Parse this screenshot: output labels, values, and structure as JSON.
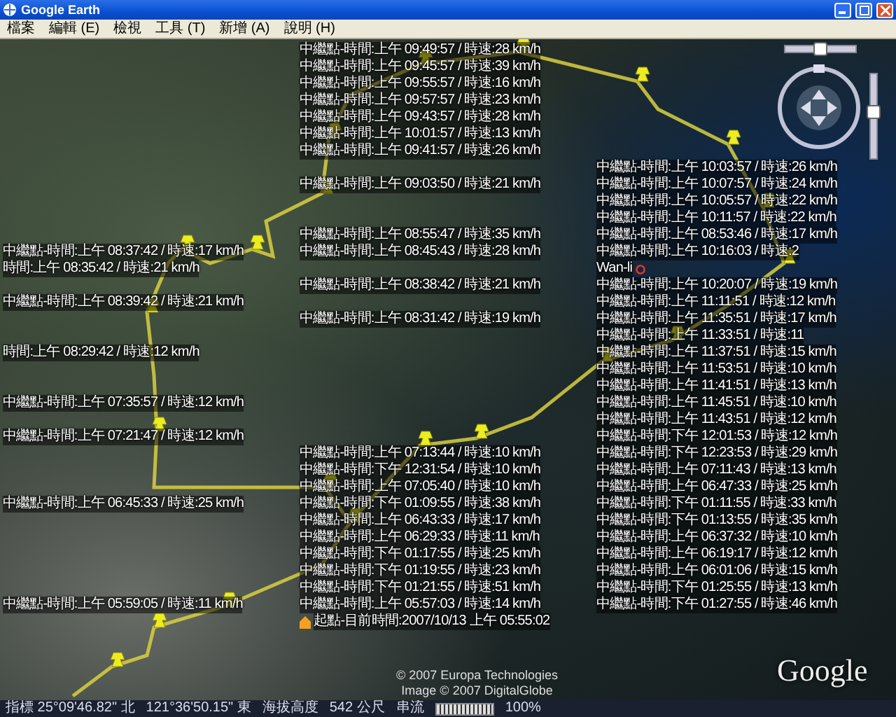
{
  "window": {
    "title": "Google Earth"
  },
  "menu": [
    "檔案",
    "編輯 (E)",
    "檢視",
    "工具 (T)",
    "新增 (A)",
    "說明 (H)"
  ],
  "map": {
    "labels": [
      {
        "kind": "waypoint",
        "text": "中繼點-時間:上午 09:49:57 / 時速:28 km/h"
      },
      {
        "kind": "waypoint",
        "text": "中繼點-時間:上午 09:45:57 / 時速:39 km/h"
      },
      {
        "kind": "waypoint",
        "text": "中繼點-時間:上午 09:55:57 / 時速:16 km/h"
      },
      {
        "kind": "waypoint",
        "text": "中繼點-時間:上午 09:57:57 / 時速:23 km/h"
      },
      {
        "kind": "waypoint",
        "text": "中繼點-時間:上午 09:43:57 / 時速:28 km/h"
      },
      {
        "kind": "waypoint",
        "text": "中繼點-時間:上午 10:01:57 / 時速:13 km/h"
      },
      {
        "kind": "waypoint",
        "text": "中繼點-時間:上午 09:41:57 / 時速:26 km/h"
      },
      {
        "kind": "waypoint",
        "text": "中繼點-時間:上午 10:03:57 / 時速:26 km/h"
      },
      {
        "kind": "waypoint",
        "text": "中繼點-時間:上午 09:03:50 / 時速:21 km/h"
      },
      {
        "kind": "waypoint",
        "text": "中繼點-時間:上午 10:07:57 / 時速:24 km/h"
      },
      {
        "kind": "waypoint",
        "text": "中繼點-時間:上午 10:05:57 / 時速:22 km/h"
      },
      {
        "kind": "waypoint",
        "text": "中繼點-時間:上午 10:11:57 / 時速:22 km/h"
      },
      {
        "kind": "waypoint",
        "text": "中繼點-時間:上午 08:55:47 / 時速:35 km/h"
      },
      {
        "kind": "waypoint",
        "text": "中繼點-時間:上午 08:53:46 / 時速:17 km/h"
      },
      {
        "kind": "waypoint",
        "text": "中繼點-時間:上午 08:37:42 / 時速:17 km/h"
      },
      {
        "kind": "waypoint",
        "text": "中繼點-時間:上午 08:45:43 / 時速:28 km/h"
      },
      {
        "kind": "waypoint",
        "text": "中繼點-時間:上午 10:16:03 / 時速:2"
      },
      {
        "kind": "waypoint",
        "text": "時間:上午 08:35:42 / 時速:21 km/h"
      },
      {
        "kind": "place",
        "text": "Wan-li"
      },
      {
        "kind": "waypoint",
        "text": "中繼點-時間:上午 08:38:42 / 時速:21 km/h"
      },
      {
        "kind": "waypoint",
        "text": "中繼點-時間:上午 10:20:07 / 時速:19 km/h"
      },
      {
        "kind": "waypoint",
        "text": "中繼點-時間:上午 08:39:42 / 時速:21 km/h"
      },
      {
        "kind": "waypoint",
        "text": "中繼點-時間:上午 11:11:51 / 時速:12 km/h"
      },
      {
        "kind": "waypoint",
        "text": "中繼點-時間:上午 08:31:42 / 時速:19 km/h"
      },
      {
        "kind": "waypoint",
        "text": "中繼點-時間:上午 11:35:51 / 時速:17 km/h"
      },
      {
        "kind": "waypoint",
        "text": "中繼點-時間:上午 11:33:51 / 時速:11"
      },
      {
        "kind": "waypoint",
        "text": "時間:上午 08:29:42 / 時速:12 km/h"
      },
      {
        "kind": "waypoint",
        "text": "中繼點-時間:上午 11:37:51 / 時速:15 km/h"
      },
      {
        "kind": "waypoint",
        "text": "中繼點-時間:上午 11:53:51 / 時速:10 km/h"
      },
      {
        "kind": "waypoint",
        "text": "中繼點-時間:上午 11:41:51 / 時速:13 km/h"
      },
      {
        "kind": "waypoint",
        "text": "中繼點-時間:上午 07:35:57 / 時速:12 km/h"
      },
      {
        "kind": "waypoint",
        "text": "中繼點-時間:上午 11:45:51 / 時速:10 km/h"
      },
      {
        "kind": "waypoint",
        "text": "中繼點-時間:上午 11:43:51 / 時速:12 km/h"
      },
      {
        "kind": "waypoint",
        "text": "中繼點-時間:上午 07:21:47 / 時速:12 km/h"
      },
      {
        "kind": "waypoint",
        "text": "中繼點-時間:下午 12:01:53 / 時速:12 km/h"
      },
      {
        "kind": "waypoint",
        "text": "中繼點-時間:上午 07:13:44 / 時速:10 km/h"
      },
      {
        "kind": "waypoint",
        "text": "中繼點-時間:下午 12:23:53 / 時速:29 km/h"
      },
      {
        "kind": "waypoint",
        "text": "中繼點-時間:下午 12:31:54 / 時速:10 km/h"
      },
      {
        "kind": "waypoint",
        "text": "中繼點-時間:上午 07:11:43 / 時速:13 km/h"
      },
      {
        "kind": "waypoint",
        "text": "中繼點-時間:上午 07:05:40 / 時速:10 km/h"
      },
      {
        "kind": "waypoint",
        "text": "中繼點-時間:上午 06:47:33 / 時速:25 km/h"
      },
      {
        "kind": "waypoint",
        "text": "中繼點-時間:上午 06:45:33 / 時速:25 km/h"
      },
      {
        "kind": "waypoint",
        "text": "中繼點-時間:下午 01:09:55 / 時速:38 km/h"
      },
      {
        "kind": "waypoint",
        "text": "中繼點-時間:下午 01:11:55 / 時速:33 km/h"
      },
      {
        "kind": "waypoint",
        "text": "中繼點-時間:上午 06:43:33 / 時速:17 km/h"
      },
      {
        "kind": "waypoint",
        "text": "中繼點-時間:下午 01:13:55 / 時速:35 km/h"
      },
      {
        "kind": "waypoint",
        "text": "中繼點-時間:上午 06:29:33 / 時速:11 km/h"
      },
      {
        "kind": "waypoint",
        "text": "中繼點-時間:上午 06:37:32 / 時速:10 km/h"
      },
      {
        "kind": "waypoint",
        "text": "中繼點-時間:下午 01:17:55 / 時速:25 km/h"
      },
      {
        "kind": "waypoint",
        "text": "中繼點-時間:上午 06:19:17 / 時速:12 km/h"
      },
      {
        "kind": "waypoint",
        "text": "中繼點-時間:下午 01:19:55 / 時速:23 km/h"
      },
      {
        "kind": "waypoint",
        "text": "中繼點-時間:上午 06:01:06 / 時速:15 km/h"
      },
      {
        "kind": "waypoint",
        "text": "中繼點-時間:下午 01:21:55 / 時速:51 km/h"
      },
      {
        "kind": "waypoint",
        "text": "中繼點-時間:下午 01:25:55 / 時速:13 km/h"
      },
      {
        "kind": "waypoint",
        "text": "中繼點-時間:上午 05:59:05 / 時速:11 km/h"
      },
      {
        "kind": "waypoint",
        "text": "中繼點-時間:上午 05:57:03 / 時速:14 km/h"
      },
      {
        "kind": "waypoint",
        "text": "中繼點-時間:下午 01:27:55 / 時速:46 km/h"
      },
      {
        "kind": "start",
        "text": "起點-目前時間:2007/10/13 上午 05:55:02"
      }
    ],
    "copyright": [
      "© 2007 Europa Technologies",
      "Image © 2007 DigitalGlobe"
    ],
    "logo": "Google",
    "tilt_slider": {
      "level": 0.5
    },
    "zoom_slider": {
      "level": 0.55
    }
  },
  "status_bar": {
    "pointer": "指標 25°09'46.82\" 北",
    "longitude": "121°36'50.15\" 東",
    "elevation_label": "海拔高度",
    "elevation": "542 公尺",
    "streaming_label": "串流",
    "streaming": {
      "level": 1
    },
    "streaming_reading": "100%"
  }
}
